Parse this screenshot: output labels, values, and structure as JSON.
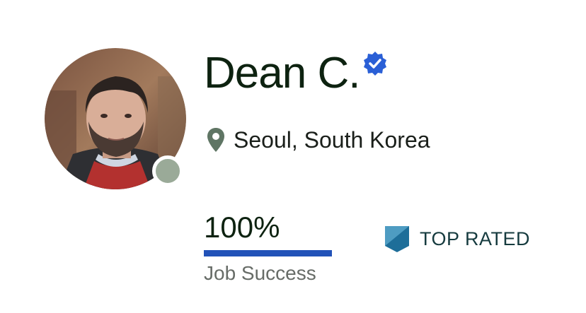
{
  "profile": {
    "name": "Dean C.",
    "location": "Seoul, South Korea",
    "status": "offline"
  },
  "job_success": {
    "value_text": "100%",
    "percent": 100,
    "label": "Job Success"
  },
  "badge": {
    "label": "TOP RATED"
  },
  "icons": {
    "verified": "verified-badge-icon",
    "location": "map-pin-icon",
    "top_rated": "top-rated-badge-icon"
  },
  "colors": {
    "name_text": "#0d2210",
    "verified": "#2a5fd6",
    "pin": "#5f7564",
    "bar_fill": "#2252b8",
    "status_dot": "#9aaa98",
    "badge_text": "#163b3f",
    "badge_light": "#4e9cc2",
    "badge_dark": "#1e6e99"
  }
}
